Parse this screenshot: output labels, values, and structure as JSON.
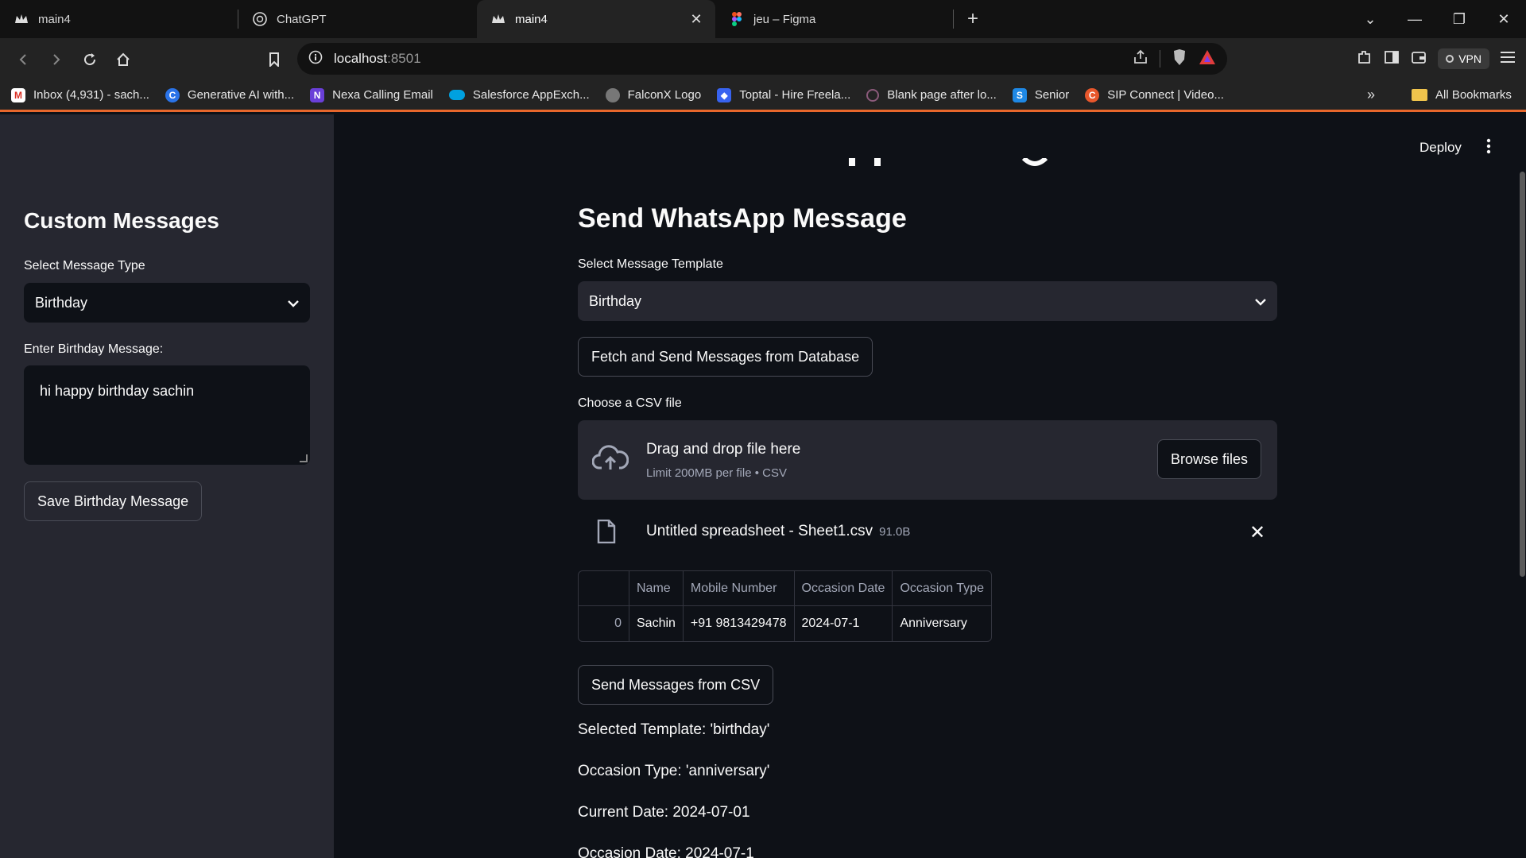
{
  "browser": {
    "tabs": [
      {
        "title": "main4",
        "icon": "streamlit-crown-icon",
        "active": false
      },
      {
        "title": "ChatGPT",
        "icon": "chatgpt-icon",
        "active": false
      },
      {
        "title": "main4",
        "icon": "streamlit-crown-icon",
        "active": true
      },
      {
        "title": "jeu – Figma",
        "icon": "figma-icon",
        "active": false
      }
    ],
    "url_host": "localhost",
    "url_port": ":8501",
    "vpn_label": "VPN",
    "bookmarks": [
      {
        "label": "Inbox (4,931) - sach...",
        "icon": "gmail-icon",
        "color": "#d93025"
      },
      {
        "label": "Generative AI with...",
        "icon": "coursera-icon",
        "color": "#2a73e8"
      },
      {
        "label": "Nexa Calling Email",
        "icon": "nexa-icon",
        "color": "#6a3fd8"
      },
      {
        "label": "Salesforce AppExch...",
        "icon": "salesforce-icon",
        "color": "#00a1e0"
      },
      {
        "label": "FalconX Logo",
        "icon": "globe-icon",
        "color": "#777777"
      },
      {
        "label": "Toptal - Hire Freela...",
        "icon": "toptal-icon",
        "color": "#3863f0"
      },
      {
        "label": "Blank page after lo...",
        "icon": "circle-icon",
        "color": "#8a5a7a"
      },
      {
        "label": "Senior",
        "icon": "s-icon",
        "color": "#1e88e5"
      },
      {
        "label": "SIP Connect | Video...",
        "icon": "sip-icon",
        "color": "#e8572c"
      }
    ],
    "all_bookmarks": "All Bookmarks"
  },
  "sidebar": {
    "title": "Custom Messages",
    "select_label": "Select Message Type",
    "select_value": "Birthday",
    "textarea_label": "Enter Birthday Message:",
    "textarea_value": "hi happy birthday sachin",
    "save_button": "Save Birthday Message"
  },
  "header": {
    "deploy": "Deploy"
  },
  "main": {
    "title": "Send WhatsApp Message",
    "template_label": "Select Message Template",
    "template_value": "Birthday",
    "fetch_button": "Fetch and Send Messages from Database",
    "csv_label": "Choose a CSV file",
    "drop_main": "Drag and drop file here",
    "drop_sub": "Limit 200MB per file • CSV",
    "browse_button": "Browse files",
    "file_name": "Untitled spreadsheet - Sheet1.csv",
    "file_size": "91.0B",
    "table": {
      "columns": [
        "Name",
        "Mobile Number",
        "Occasion Date",
        "Occasion Type"
      ],
      "rows": [
        {
          "index": "0",
          "cells": [
            "Sachin",
            "+91 9813429478",
            "2024-07-1",
            "Anniversary"
          ]
        }
      ]
    },
    "send_csv_button": "Send Messages from CSV",
    "info_lines": [
      "Selected Template: 'birthday'",
      "Occasion Type: 'anniversary'",
      "Current Date: 2024-07-01",
      "Occasion Date: 2024-07-1"
    ]
  }
}
